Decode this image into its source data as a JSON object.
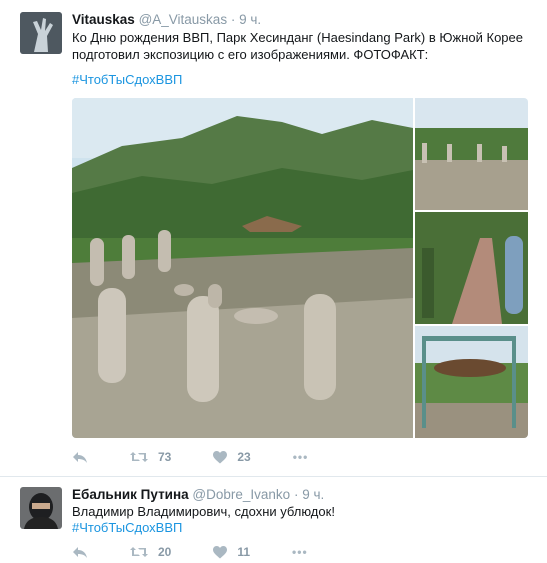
{
  "tweets": [
    {
      "author_name": "Vitauskas",
      "handle": "@A_Vitauskas",
      "separator": "·",
      "time": "9 ч.",
      "text": "Ко Дню рождения ВВП, Парк Хесинданг (Haesindang Park) в Южной Корее подготовил экспозицию с его изображениями. ФОТОФАКТ:",
      "hashtag": "#ЧтобТыСдохВВП",
      "retweets": "73",
      "likes": "23",
      "more": "•••"
    },
    {
      "author_name": "Ебальник Путина",
      "handle": "@Dobre_Ivanko",
      "separator": "·",
      "time": "9 ч.",
      "text": "Владимир Владимирович, сдохни ублюдок!",
      "hashtag": "#ЧтобТыСдохВВП",
      "retweets": "20",
      "likes": "11",
      "more": "•••"
    }
  ],
  "icons": {
    "reply": "reply-icon",
    "retweet": "retweet-icon",
    "like": "heart-icon",
    "more": "more-icon"
  },
  "colors": {
    "hashtag": "#1b95e0",
    "muted": "#8899a6",
    "text": "#14171a",
    "divider": "#e1e8ed"
  }
}
